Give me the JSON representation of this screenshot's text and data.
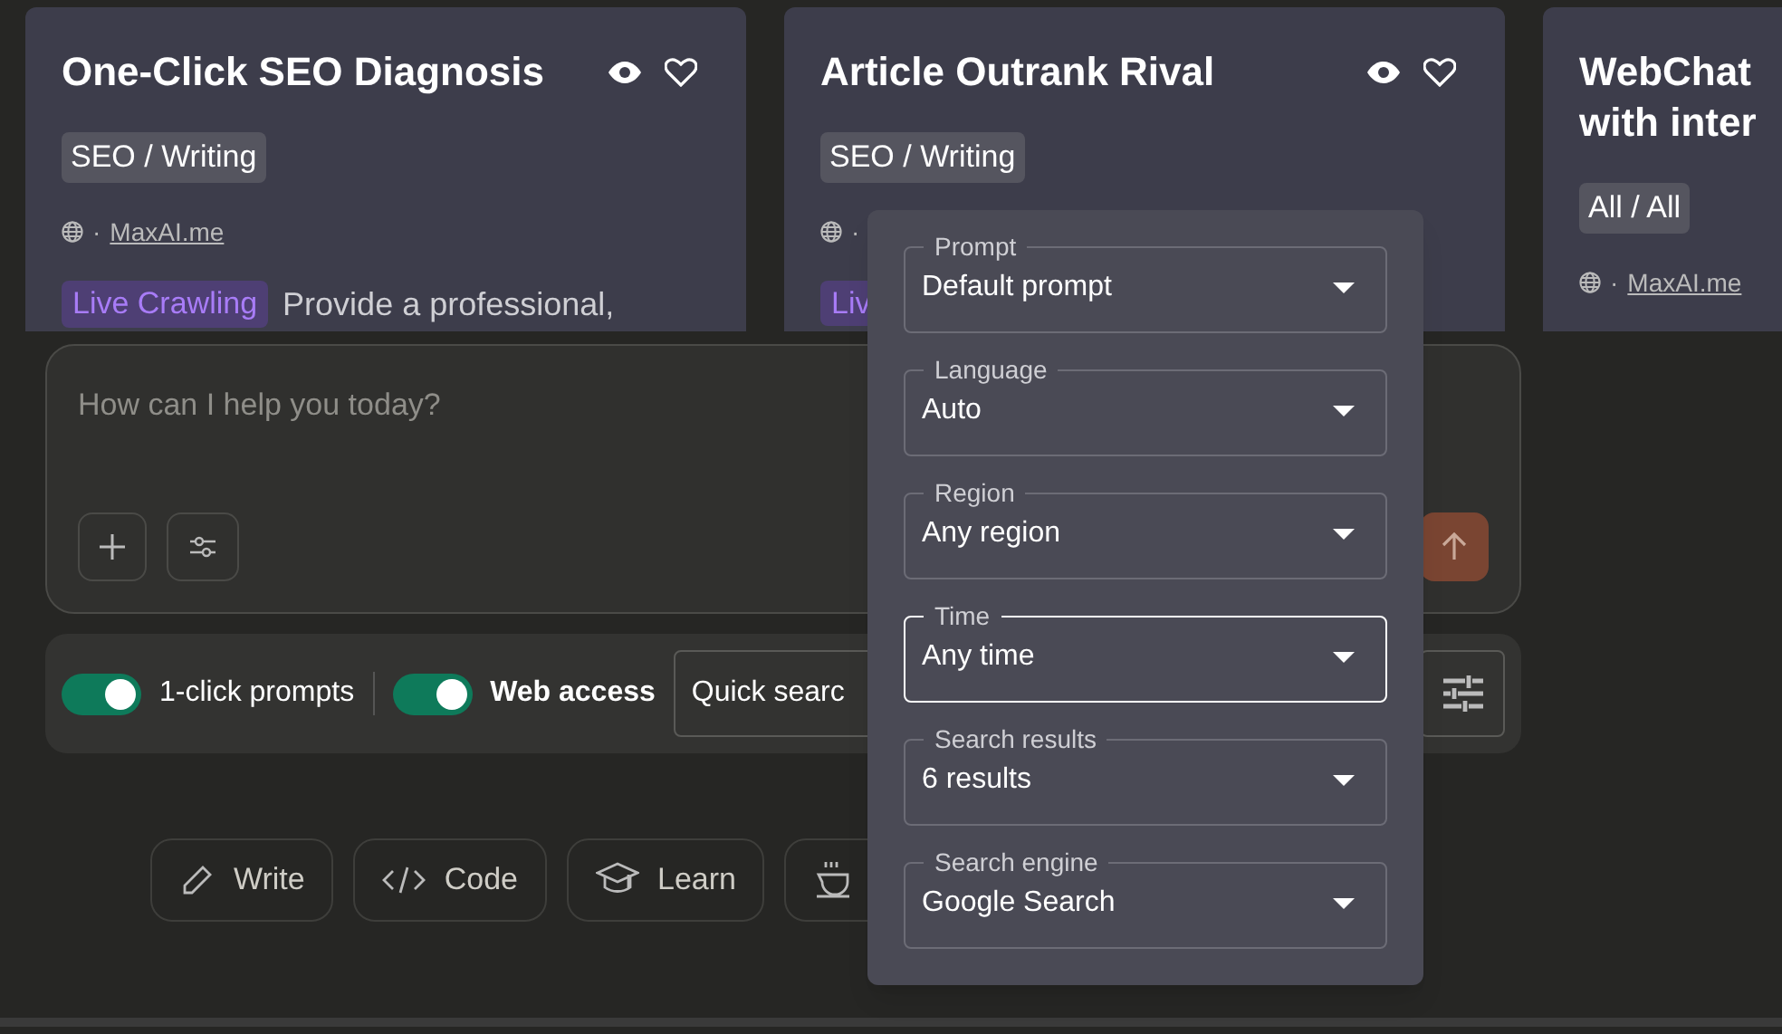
{
  "cards": [
    {
      "title_lines": [
        "One-Click SEO Diagnosis"
      ],
      "category": "SEO / Writing",
      "meta": {
        "separator": "·",
        "link": "MaxAI.me"
      },
      "description": {
        "badge": "Live Crawling",
        "text": "Provide a professional,"
      }
    },
    {
      "title_lines": [
        "Article Outrank Rival"
      ],
      "category": "SEO / Writing",
      "meta": {
        "separator": "·"
      },
      "description": {
        "badge": "Liv"
      }
    },
    {
      "title_lines": [
        "WebChat",
        "with inter"
      ],
      "category": "All / All",
      "meta": {
        "separator": "·",
        "link": "MaxAI.me"
      }
    }
  ],
  "composer": {
    "placeholder": "How can I help you today?"
  },
  "toolbar": {
    "toggles": [
      {
        "label": "1-click prompts",
        "on": true,
        "bold": false
      },
      {
        "label": "Web access",
        "on": true,
        "bold": true
      }
    ],
    "search_mode": "Quick searc"
  },
  "suggestions": [
    {
      "kind": "pencil",
      "label": "Write"
    },
    {
      "kind": "code",
      "label": "Code"
    },
    {
      "kind": "cap",
      "label": "Learn"
    },
    {
      "kind": "cup"
    }
  ],
  "settings_popup": {
    "fields": [
      {
        "label": "Prompt",
        "value": "Default prompt",
        "focused": false
      },
      {
        "label": "Language",
        "value": "Auto",
        "focused": false
      },
      {
        "label": "Region",
        "value": "Any region",
        "focused": false
      },
      {
        "label": "Time",
        "value": "Any time",
        "focused": true
      },
      {
        "label": "Search results",
        "value": "6 results",
        "focused": false
      },
      {
        "label": "Search engine",
        "value": "Google Search",
        "focused": false
      }
    ]
  }
}
